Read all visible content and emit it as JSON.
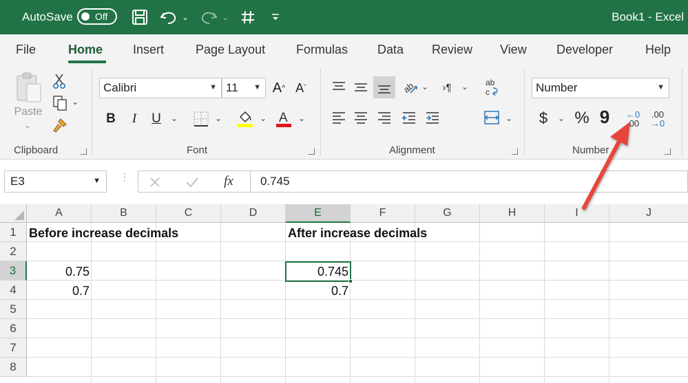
{
  "titlebar": {
    "autosave_label": "AutoSave",
    "autosave_state": "Off",
    "title": "Book1  -  Excel"
  },
  "tabs": [
    "File",
    "Home",
    "Insert",
    "Page Layout",
    "Formulas",
    "Data",
    "Review",
    "View",
    "Developer",
    "Help"
  ],
  "active_tab": "Home",
  "ribbon": {
    "clipboard": {
      "label": "Clipboard",
      "paste_label": "Paste"
    },
    "font": {
      "label": "Font",
      "font_name": "Calibri",
      "font_size": "11",
      "bold": "B",
      "italic": "I",
      "underline": "U",
      "grow": "A",
      "shrink": "A"
    },
    "alignment": {
      "label": "Alignment"
    },
    "number": {
      "label": "Number",
      "format": "Number",
      "currency": "$",
      "percent": "%",
      "comma": "9",
      "increase_decimal_top": "←0",
      "increase_decimal_bottom": ".00",
      "decrease_decimal_top": ".00",
      "decrease_decimal_bottom": "→0"
    }
  },
  "formula_bar": {
    "name_box": "E3",
    "fx": "fx",
    "value": "0.745"
  },
  "grid": {
    "columns": [
      "A",
      "B",
      "C",
      "D",
      "E",
      "F",
      "G",
      "H",
      "I",
      "J"
    ],
    "selected_column": "E",
    "rows": [
      "1",
      "2",
      "3",
      "4",
      "5",
      "6",
      "7",
      "8"
    ],
    "selected_row": "3",
    "cells": {
      "A1": "Before increase decimals",
      "E1": "After increase decimals",
      "A3": "0.75",
      "A4": "0.7",
      "E3": "0.745",
      "E4": "0.7"
    }
  },
  "colors": {
    "excel_green": "#217346",
    "annotation_arrow": "#e8453c"
  }
}
